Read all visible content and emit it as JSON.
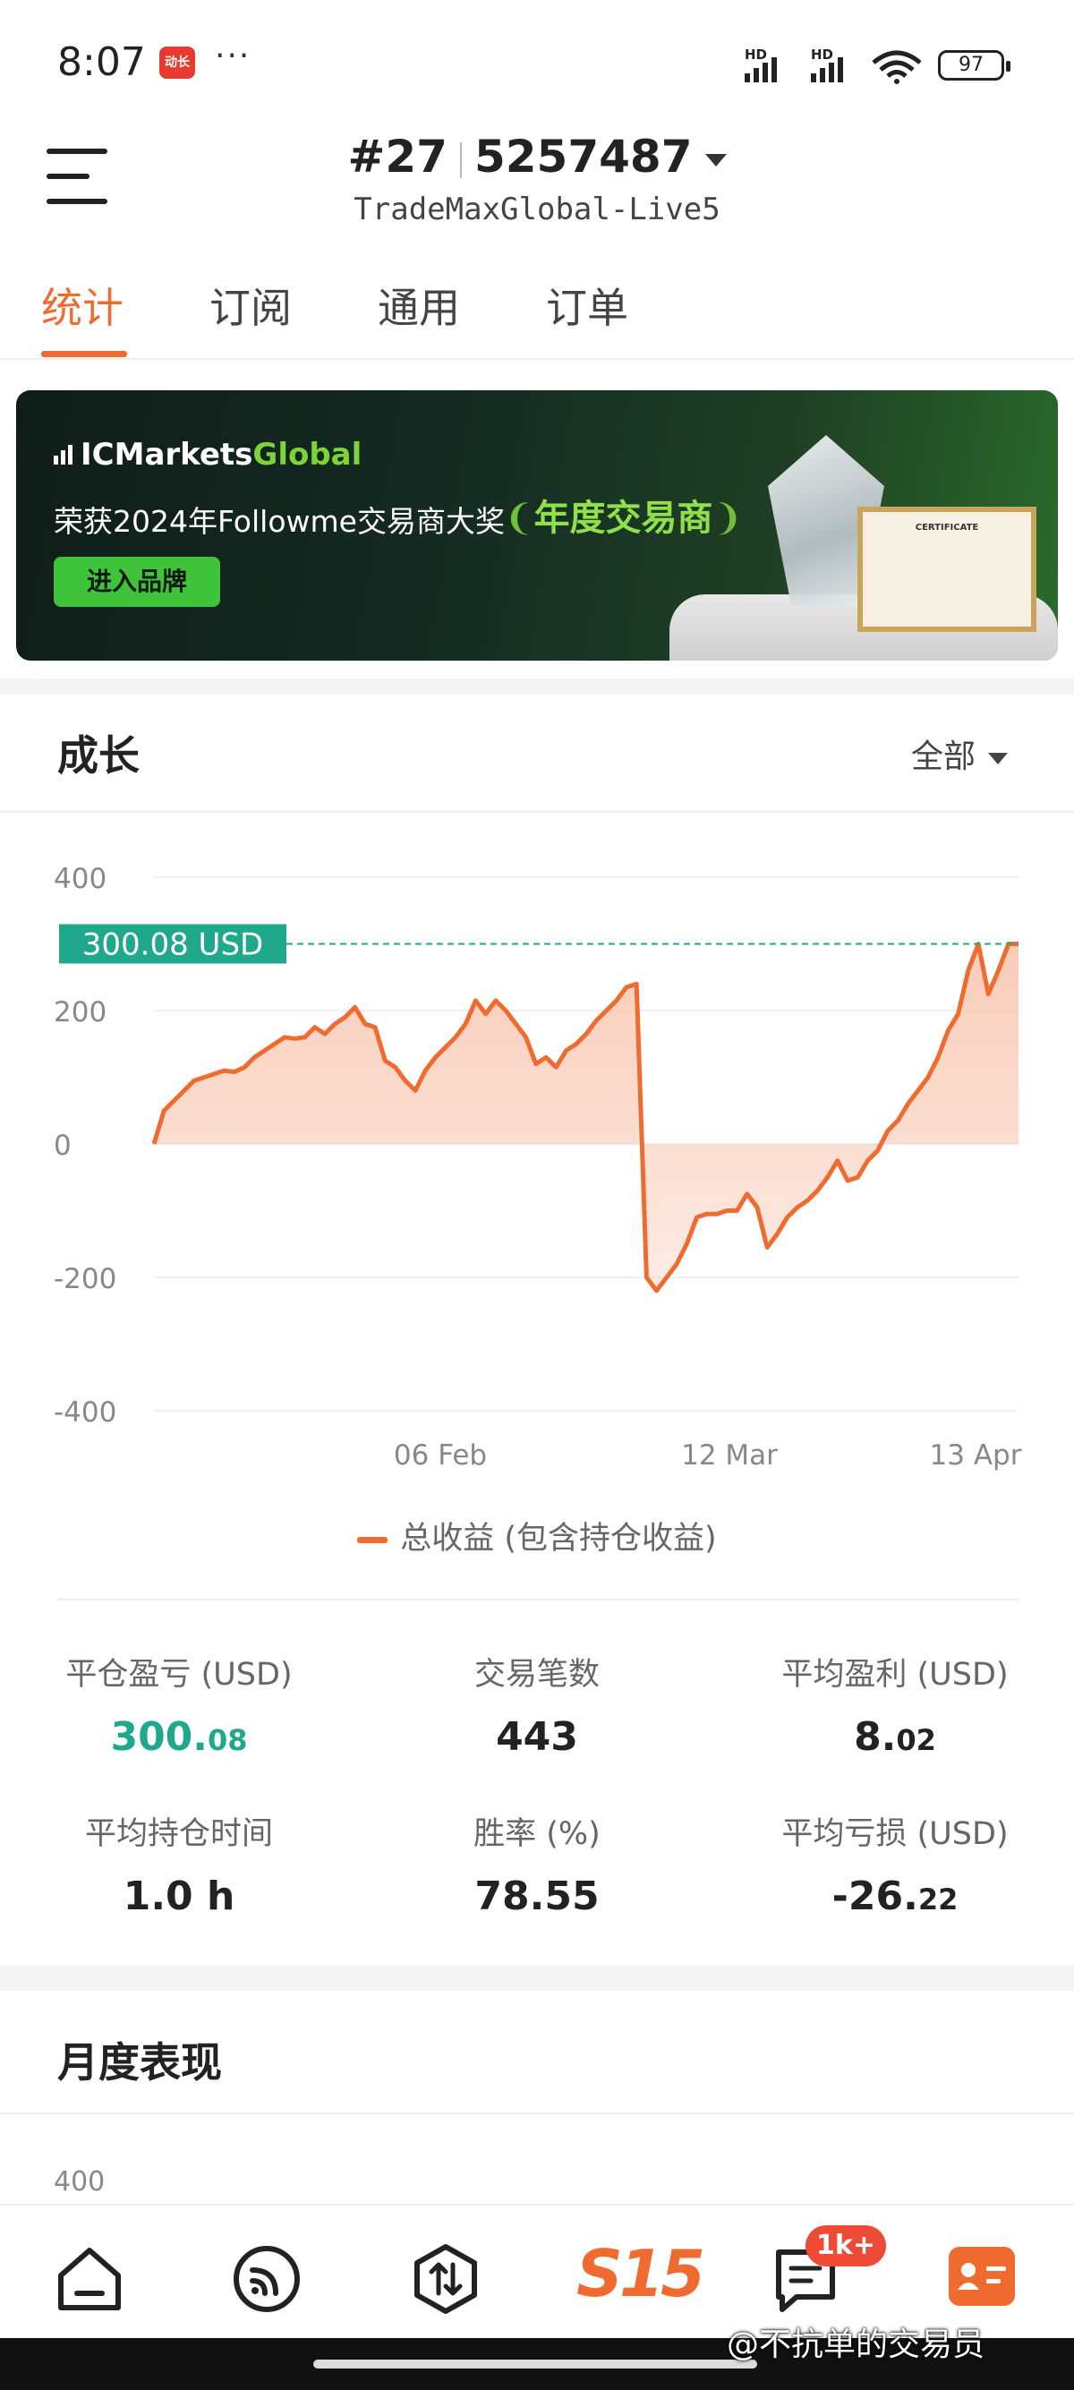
{
  "status_bar": {
    "time": "8:07",
    "app_badge": "动长",
    "dots": "···",
    "signal_1": "HD",
    "signal_2": "HD",
    "battery": "97"
  },
  "header": {
    "account_no": "#27",
    "account_id": "5257487",
    "server": "TradeMaxGlobal-Live5"
  },
  "tabs": [
    {
      "label": "统计",
      "active": true
    },
    {
      "label": "订阅",
      "active": false
    },
    {
      "label": "通用",
      "active": false
    },
    {
      "label": "订单",
      "active": false
    }
  ],
  "banner": {
    "logo_ic": "IC",
    "logo_markets": "Markets",
    "logo_global": "Global",
    "subtitle": "荣获2024年Followme交易商大奖",
    "award": "年度交易商",
    "button": "进入品牌",
    "cert_title": "CERTIFICATE"
  },
  "growth": {
    "title": "成长",
    "range": "全部",
    "legend": "总收益 (包含持仓收益)"
  },
  "chart_data": {
    "type": "area",
    "title": "",
    "xlabel": "",
    "ylabel": "",
    "ylim": [
      -400,
      400
    ],
    "yticks": [
      400,
      200,
      0,
      -200,
      -400
    ],
    "xtick_labels": [
      "06 Feb",
      "12 Mar",
      "13 Apr"
    ],
    "current_label": "300.08 USD",
    "current_value": 300.08,
    "colors": {
      "line": "#ef6b2f",
      "fill": "#f9c9b4",
      "marker": "#1fa88b"
    },
    "series": [
      {
        "name": "总收益 (包含持仓收益)",
        "values": [
          0,
          50,
          65,
          80,
          95,
          100,
          105,
          110,
          108,
          115,
          130,
          140,
          150,
          160,
          158,
          160,
          175,
          165,
          180,
          190,
          205,
          180,
          175,
          125,
          115,
          95,
          80,
          110,
          130,
          145,
          160,
          180,
          215,
          195,
          215,
          200,
          180,
          160,
          120,
          130,
          115,
          140,
          150,
          165,
          185,
          200,
          215,
          235,
          240,
          -200,
          -220,
          -200,
          -180,
          -150,
          -110,
          -105,
          -105,
          -100,
          -100,
          -75,
          -95,
          -155,
          -135,
          -110,
          -95,
          -85,
          -70,
          -50,
          -25,
          -55,
          -50,
          -25,
          -10,
          20,
          35,
          60,
          80,
          100,
          130,
          170,
          195,
          260,
          300,
          225,
          260,
          300,
          300
        ]
      }
    ]
  },
  "stats": [
    {
      "label": "平仓盈亏 (USD)",
      "value_main": "300.",
      "value_frac": "08",
      "color": "#1fa88b"
    },
    {
      "label": "交易笔数",
      "value_main": "443",
      "value_frac": "",
      "color": "#222222"
    },
    {
      "label": "平均盈利 (USD)",
      "value_main": "8.",
      "value_frac": "02",
      "color": "#222222"
    },
    {
      "label": "平均持仓时间",
      "value_main": "1.0 h",
      "value_frac": "",
      "color": "#222222"
    },
    {
      "label": "胜率 (%)",
      "value_main": "78.55",
      "value_frac": "",
      "color": "#222222"
    },
    {
      "label": "平均亏损 (USD)",
      "value_main": "-26.",
      "value_frac": "22",
      "color": "#222222"
    }
  ],
  "monthly": {
    "title": "月度表现",
    "axis_top": "400"
  },
  "bottom_nav": {
    "s15": "S15",
    "badge": "1k+",
    "watermark": "@不抗单的交易员"
  }
}
